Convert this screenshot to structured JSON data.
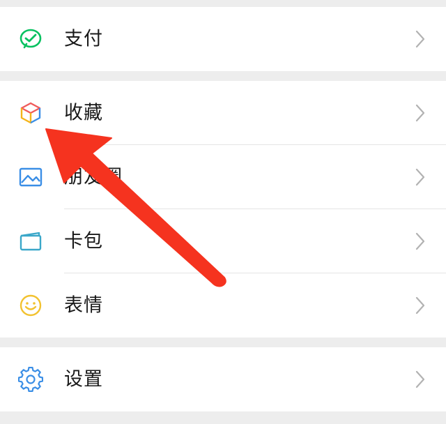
{
  "menu": {
    "pay": {
      "label": "支付",
      "icon": "wechat-pay-icon"
    },
    "favorites": {
      "label": "收藏",
      "icon": "favorites-cube-icon"
    },
    "moments": {
      "label": "朋友圈",
      "icon": "moments-picture-icon"
    },
    "cards": {
      "label": "卡包",
      "icon": "card-wallet-icon"
    },
    "stickers": {
      "label": "表情",
      "icon": "smiley-sticker-icon"
    },
    "settings": {
      "label": "设置",
      "icon": "settings-gear-icon"
    }
  },
  "colors": {
    "background": "#ededed",
    "pay_green": "#07c160",
    "arrow_red": "#f5331f",
    "label_text": "#191919",
    "chevron": "#b2b2b2"
  },
  "annotation": {
    "type": "arrow",
    "points_to": "favorites"
  }
}
